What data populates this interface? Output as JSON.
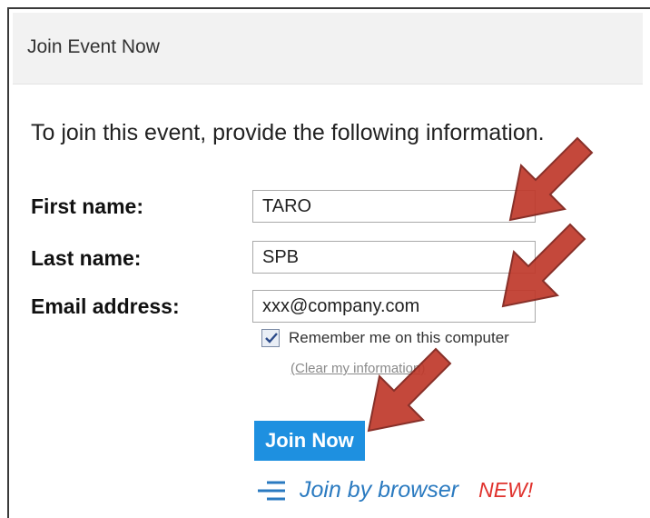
{
  "panel": {
    "title": "Join Event Now",
    "intro": "To join this event, provide the following information."
  },
  "form": {
    "first_name_label": "First name:",
    "first_name_value": "TARO",
    "last_name_label": "Last name:",
    "last_name_value": "SPB",
    "email_label": "Email address:",
    "email_value": "xxx@company.com",
    "remember_label": "Remember me on this computer",
    "remember_checked": true,
    "clear_link": "(Clear my information)"
  },
  "actions": {
    "join_label": "Join Now",
    "browser_label": "Join by browser",
    "new_badge": "NEW!"
  },
  "colors": {
    "join_button": "#1e90e0",
    "browser_link": "#2a7ac0",
    "new_badge": "#e0322d",
    "annotation_arrow": "#c0392b"
  },
  "annotations": [
    {
      "icon": "pointer-arrow",
      "target": "first-name-field"
    },
    {
      "icon": "pointer-arrow",
      "target": "email-field"
    },
    {
      "icon": "pointer-arrow",
      "target": "join-now-button"
    }
  ]
}
